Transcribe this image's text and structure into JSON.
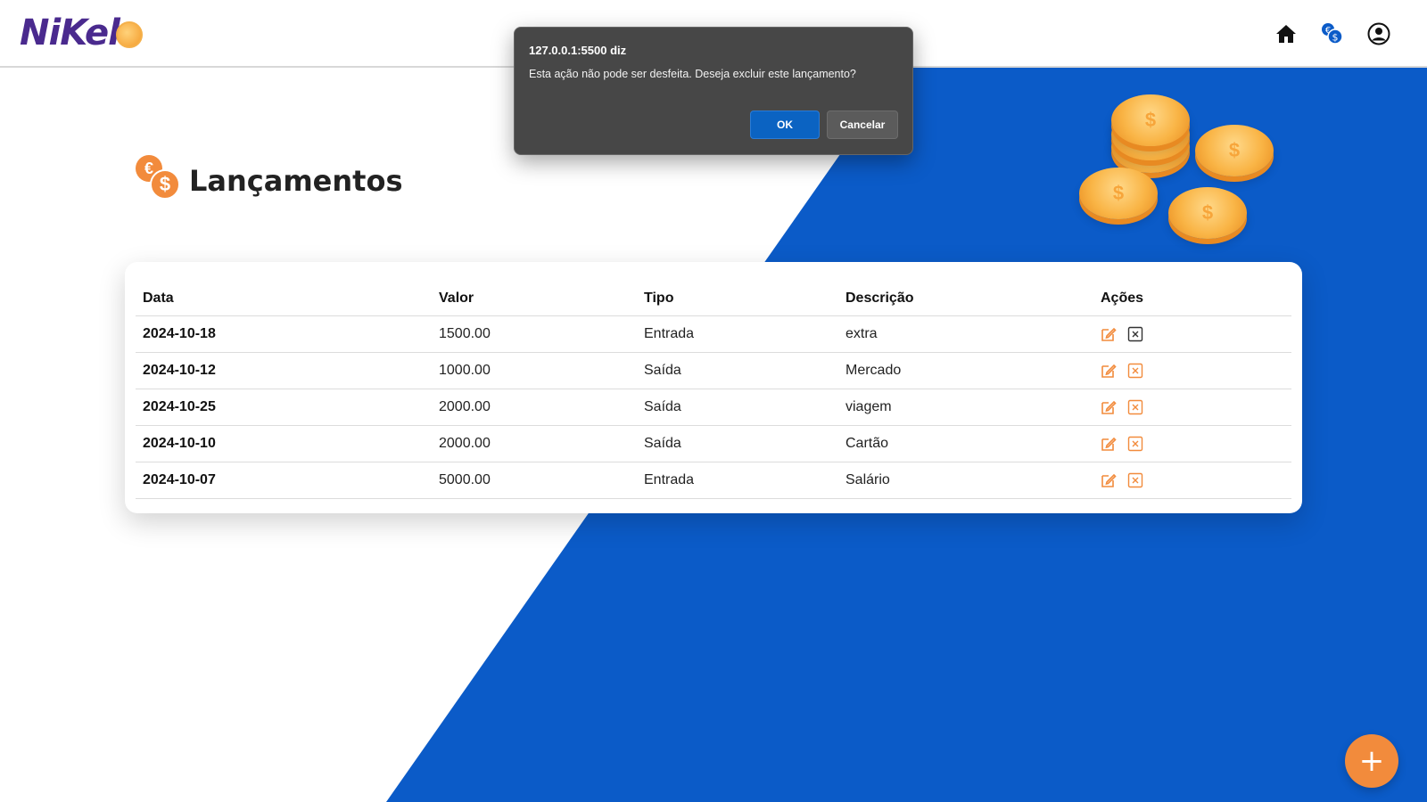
{
  "colors": {
    "accent": "#f28b3c",
    "blue": "#0b5bc8",
    "logo": "#4a2a8e"
  },
  "navbar": {
    "logo_text": "NiKel",
    "icons": [
      "home-icon",
      "currency-icon",
      "user-icon"
    ]
  },
  "page": {
    "title": "Lançamentos"
  },
  "table": {
    "headers": {
      "data": "Data",
      "valor": "Valor",
      "tipo": "Tipo",
      "descricao": "Descrição",
      "acoes": "Ações"
    },
    "rows": [
      {
        "data": "2024-10-18",
        "valor": "1500.00",
        "tipo": "Entrada",
        "descricao": "extra"
      },
      {
        "data": "2024-10-12",
        "valor": "1000.00",
        "tipo": "Saída",
        "descricao": "Mercado"
      },
      {
        "data": "2024-10-25",
        "valor": "2000.00",
        "tipo": "Saída",
        "descricao": "viagem"
      },
      {
        "data": "2024-10-10",
        "valor": "2000.00",
        "tipo": "Saída",
        "descricao": "Cartão"
      },
      {
        "data": "2024-10-07",
        "valor": "5000.00",
        "tipo": "Entrada",
        "descricao": "Salário"
      }
    ]
  },
  "dialog": {
    "title": "127.0.0.1:5500 diz",
    "message": "Esta ação não pode ser desfeita. Deseja excluir este lançamento?",
    "ok_label": "OK",
    "cancel_label": "Cancelar"
  },
  "fab": {
    "label": "+"
  }
}
